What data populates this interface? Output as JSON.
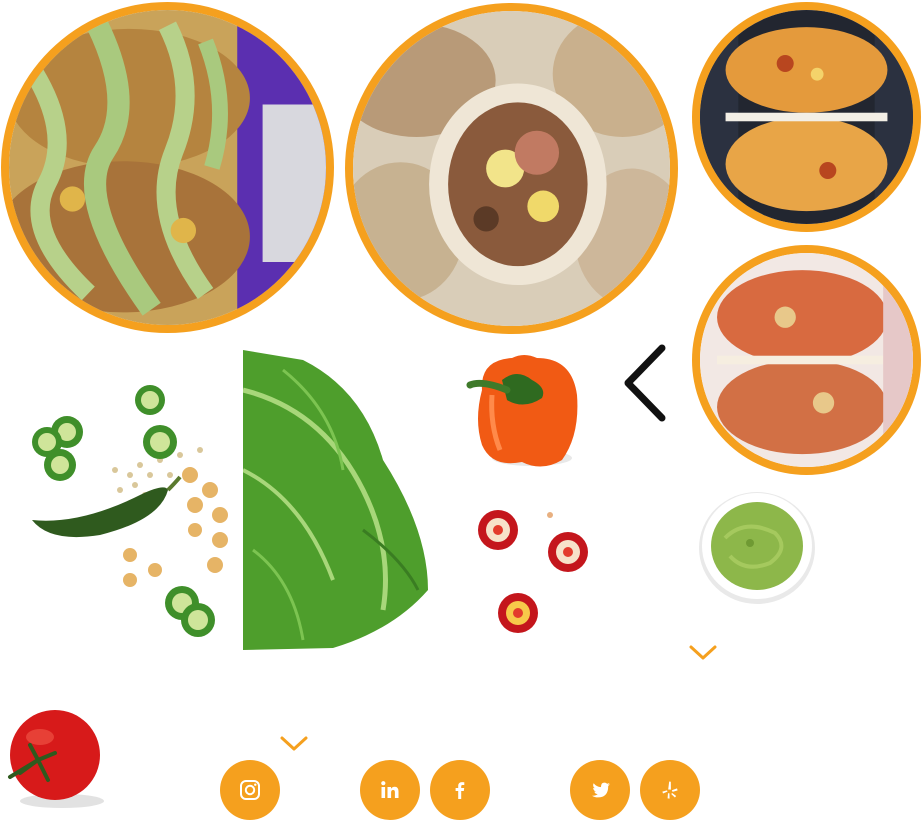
{
  "colors": {
    "accent": "#f5a01e",
    "background": "#ffffff",
    "arrow": "#111111"
  },
  "gallery": {
    "prev_icon": "chevron-left-icon",
    "photos": [
      {
        "name": "burrito-green-sauce-photo"
      },
      {
        "name": "burrito-cross-section-photo"
      },
      {
        "name": "burrito-egg-cheese-photo"
      },
      {
        "name": "burrito-red-salsa-photo"
      }
    ]
  },
  "ingredients": [
    "jalapeno-chickpeas-image",
    "romaine-lettuce-image",
    "orange-bell-pepper-image",
    "red-chili-slices-image",
    "guacamole-bowl-image",
    "tomato-image"
  ],
  "scroll_icons": [
    "chevron-down-icon",
    "chevron-down-icon"
  ],
  "social": [
    {
      "name": "instagram-button",
      "icon": "instagram-icon"
    },
    {
      "name": "linkedin-button",
      "icon": "linkedin-icon"
    },
    {
      "name": "facebook-button",
      "icon": "facebook-icon"
    },
    {
      "name": "twitter-button",
      "icon": "twitter-icon"
    },
    {
      "name": "yelp-button",
      "icon": "yelp-icon"
    }
  ]
}
